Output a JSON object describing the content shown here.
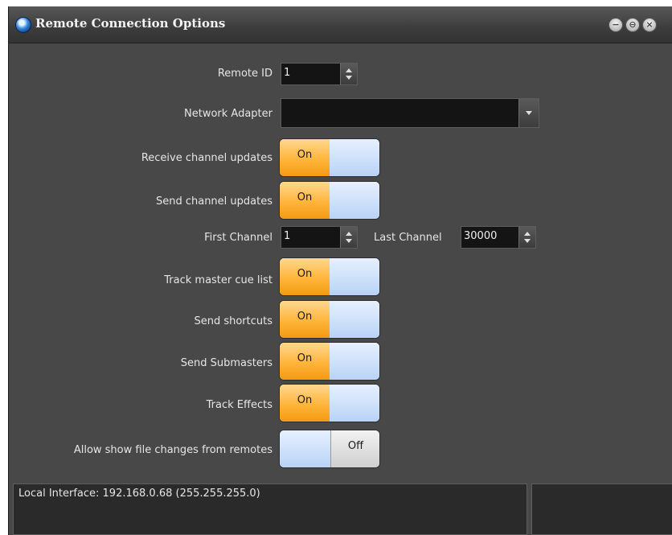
{
  "window": {
    "title": "Remote Connection Options",
    "buttons": {
      "minimize": "−",
      "restore": "⊖",
      "close": "×"
    }
  },
  "form": {
    "remote_id": {
      "label": "Remote ID",
      "value": "1"
    },
    "network_adapter": {
      "label": "Network Adapter",
      "value": ""
    },
    "receive_channel_updates": {
      "label": "Receive channel updates",
      "state": "On"
    },
    "send_channel_updates": {
      "label": "Send channel updates",
      "state": "On"
    },
    "first_channel": {
      "label": "First Channel",
      "value": "1"
    },
    "last_channel": {
      "label": "Last Channel",
      "value": "30000"
    },
    "track_master_cue_list": {
      "label": "Track master cue list",
      "state": "On"
    },
    "send_shortcuts": {
      "label": "Send shortcuts",
      "state": "On"
    },
    "send_submasters": {
      "label": "Send Submasters",
      "state": "On"
    },
    "track_effects": {
      "label": "Track Effects",
      "state": "On"
    },
    "allow_show_file_changes": {
      "label": "Allow show file changes from remotes",
      "state": "Off"
    }
  },
  "status": {
    "local_interface": "Local Interface: 192.168.0.68 (255.255.255.0)"
  },
  "colors": {
    "toggle_on": "#ffb53a",
    "toggle_off_track": "#cfe2fa",
    "background": "#484848"
  }
}
